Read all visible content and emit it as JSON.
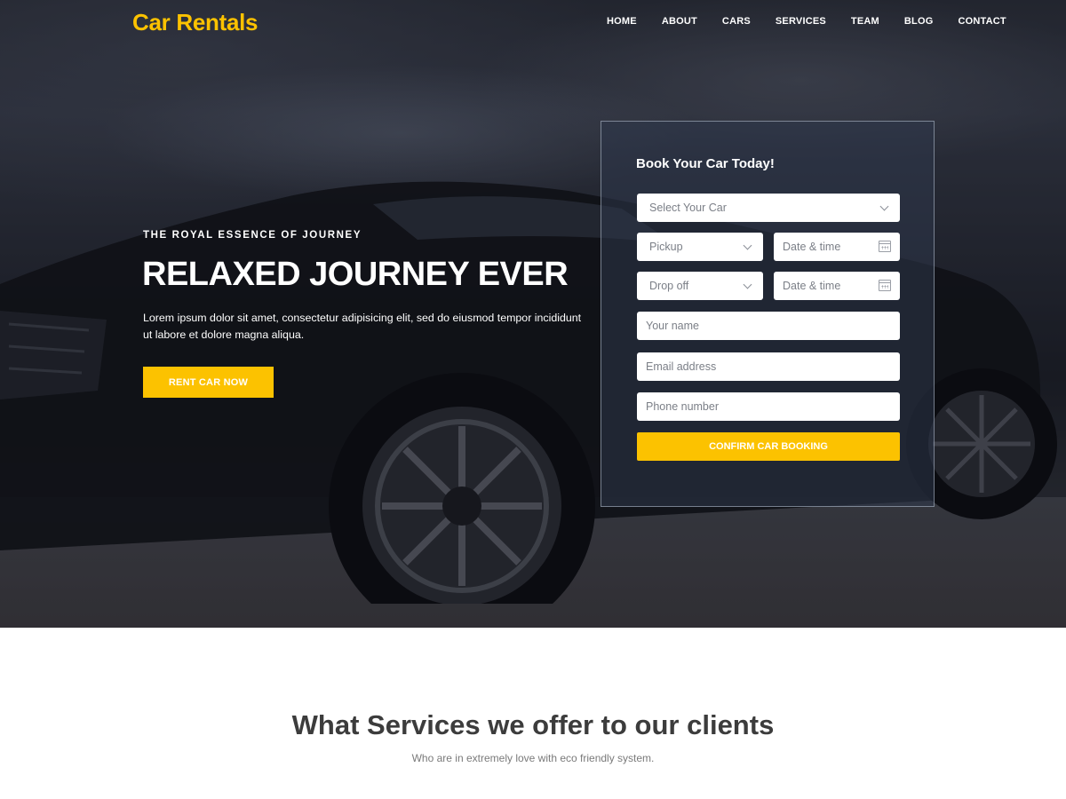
{
  "header": {
    "logo": "Car Rentals",
    "nav": [
      "HOME",
      "ABOUT",
      "CARS",
      "SERVICES",
      "TEAM",
      "BLOG",
      "CONTACT"
    ]
  },
  "hero": {
    "kicker": "THE ROYAL ESSENCE OF JOURNEY",
    "headline": "RELAXED JOURNEY EVER",
    "lead": "Lorem ipsum dolor sit amet, consectetur adipisicing elit, sed do eiusmod tempor incididunt ut labore et dolore magna aliqua.",
    "cta": "RENT CAR NOW"
  },
  "booking": {
    "title": "Book Your Car Today!",
    "select_car": "Select Your Car",
    "pickup": "Pickup",
    "dropoff": "Drop off",
    "date_placeholder": "Date & time",
    "name_placeholder": "Your name",
    "email_placeholder": "Email address",
    "phone_placeholder": "Phone number",
    "confirm": "CONFIRM CAR BOOKING"
  },
  "services": {
    "title": "What Services we offer to our clients",
    "subtitle": "Who are in extremely love with eco friendly system."
  },
  "colors": {
    "accent": "#fcc200",
    "hero_dark": "#1c1f27",
    "heading_dark": "#3c3c3c"
  },
  "icons": [
    "chevron-down-icon",
    "calendar-icon"
  ]
}
